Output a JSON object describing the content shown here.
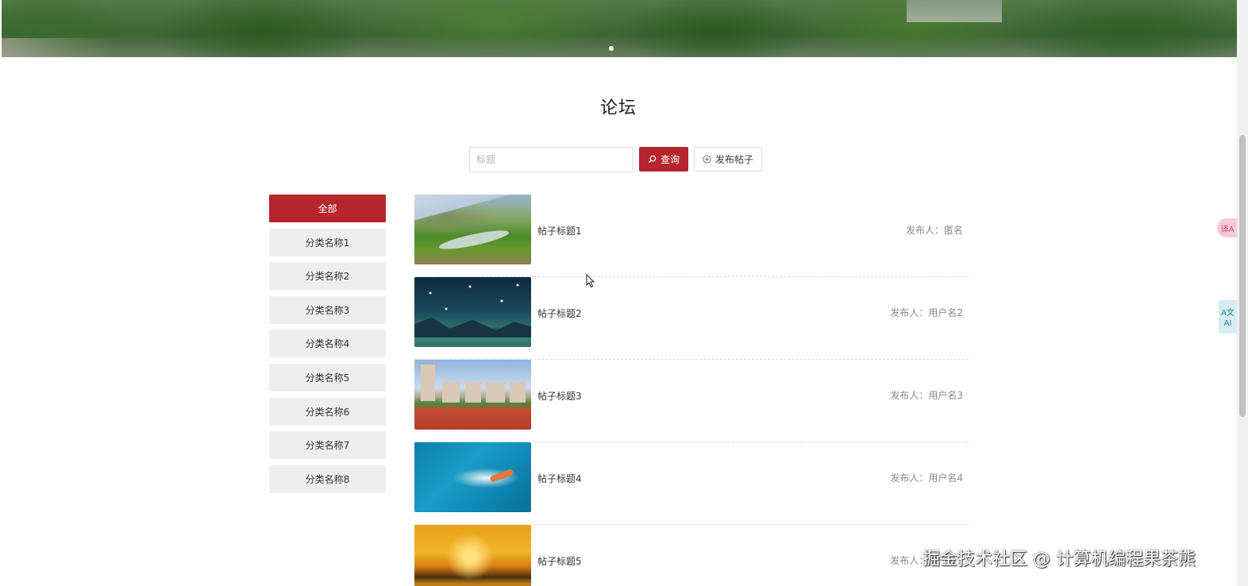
{
  "page": {
    "title": "论坛"
  },
  "search": {
    "placeholder": "标题",
    "query_label": "查询",
    "post_label": "发布帖子"
  },
  "categories": [
    {
      "label": "全部",
      "active": true
    },
    {
      "label": "分类名称1",
      "active": false
    },
    {
      "label": "分类名称2",
      "active": false
    },
    {
      "label": "分类名称3",
      "active": false
    },
    {
      "label": "分类名称4",
      "active": false
    },
    {
      "label": "分类名称5",
      "active": false
    },
    {
      "label": "分类名称6",
      "active": false
    },
    {
      "label": "分类名称7",
      "active": false
    },
    {
      "label": "分类名称8",
      "active": false
    }
  ],
  "posts": [
    {
      "title": "帖子标题1",
      "author": "发布人：匿名",
      "image": "valley-river"
    },
    {
      "title": "帖子标题2",
      "author": "发布人：用户名2",
      "image": "starry-mountains"
    },
    {
      "title": "帖子标题3",
      "author": "发布人：用户名3",
      "image": "running-track"
    },
    {
      "title": "帖子标题4",
      "author": "发布人：用户名4",
      "image": "swimming-pool"
    },
    {
      "title": "帖子标题5",
      "author": "发布人：用户名5",
      "image": "sunset-lake"
    }
  ],
  "widgets": {
    "translate_label": "译A",
    "ai_top": "A文",
    "ai_bottom": "AI"
  },
  "watermark": "掘金技术社区 @ 计算机编程果茶熊",
  "colors": {
    "accent": "#b5252d",
    "category_bg": "#eeeeee",
    "text": "#333333",
    "muted": "#888888"
  }
}
